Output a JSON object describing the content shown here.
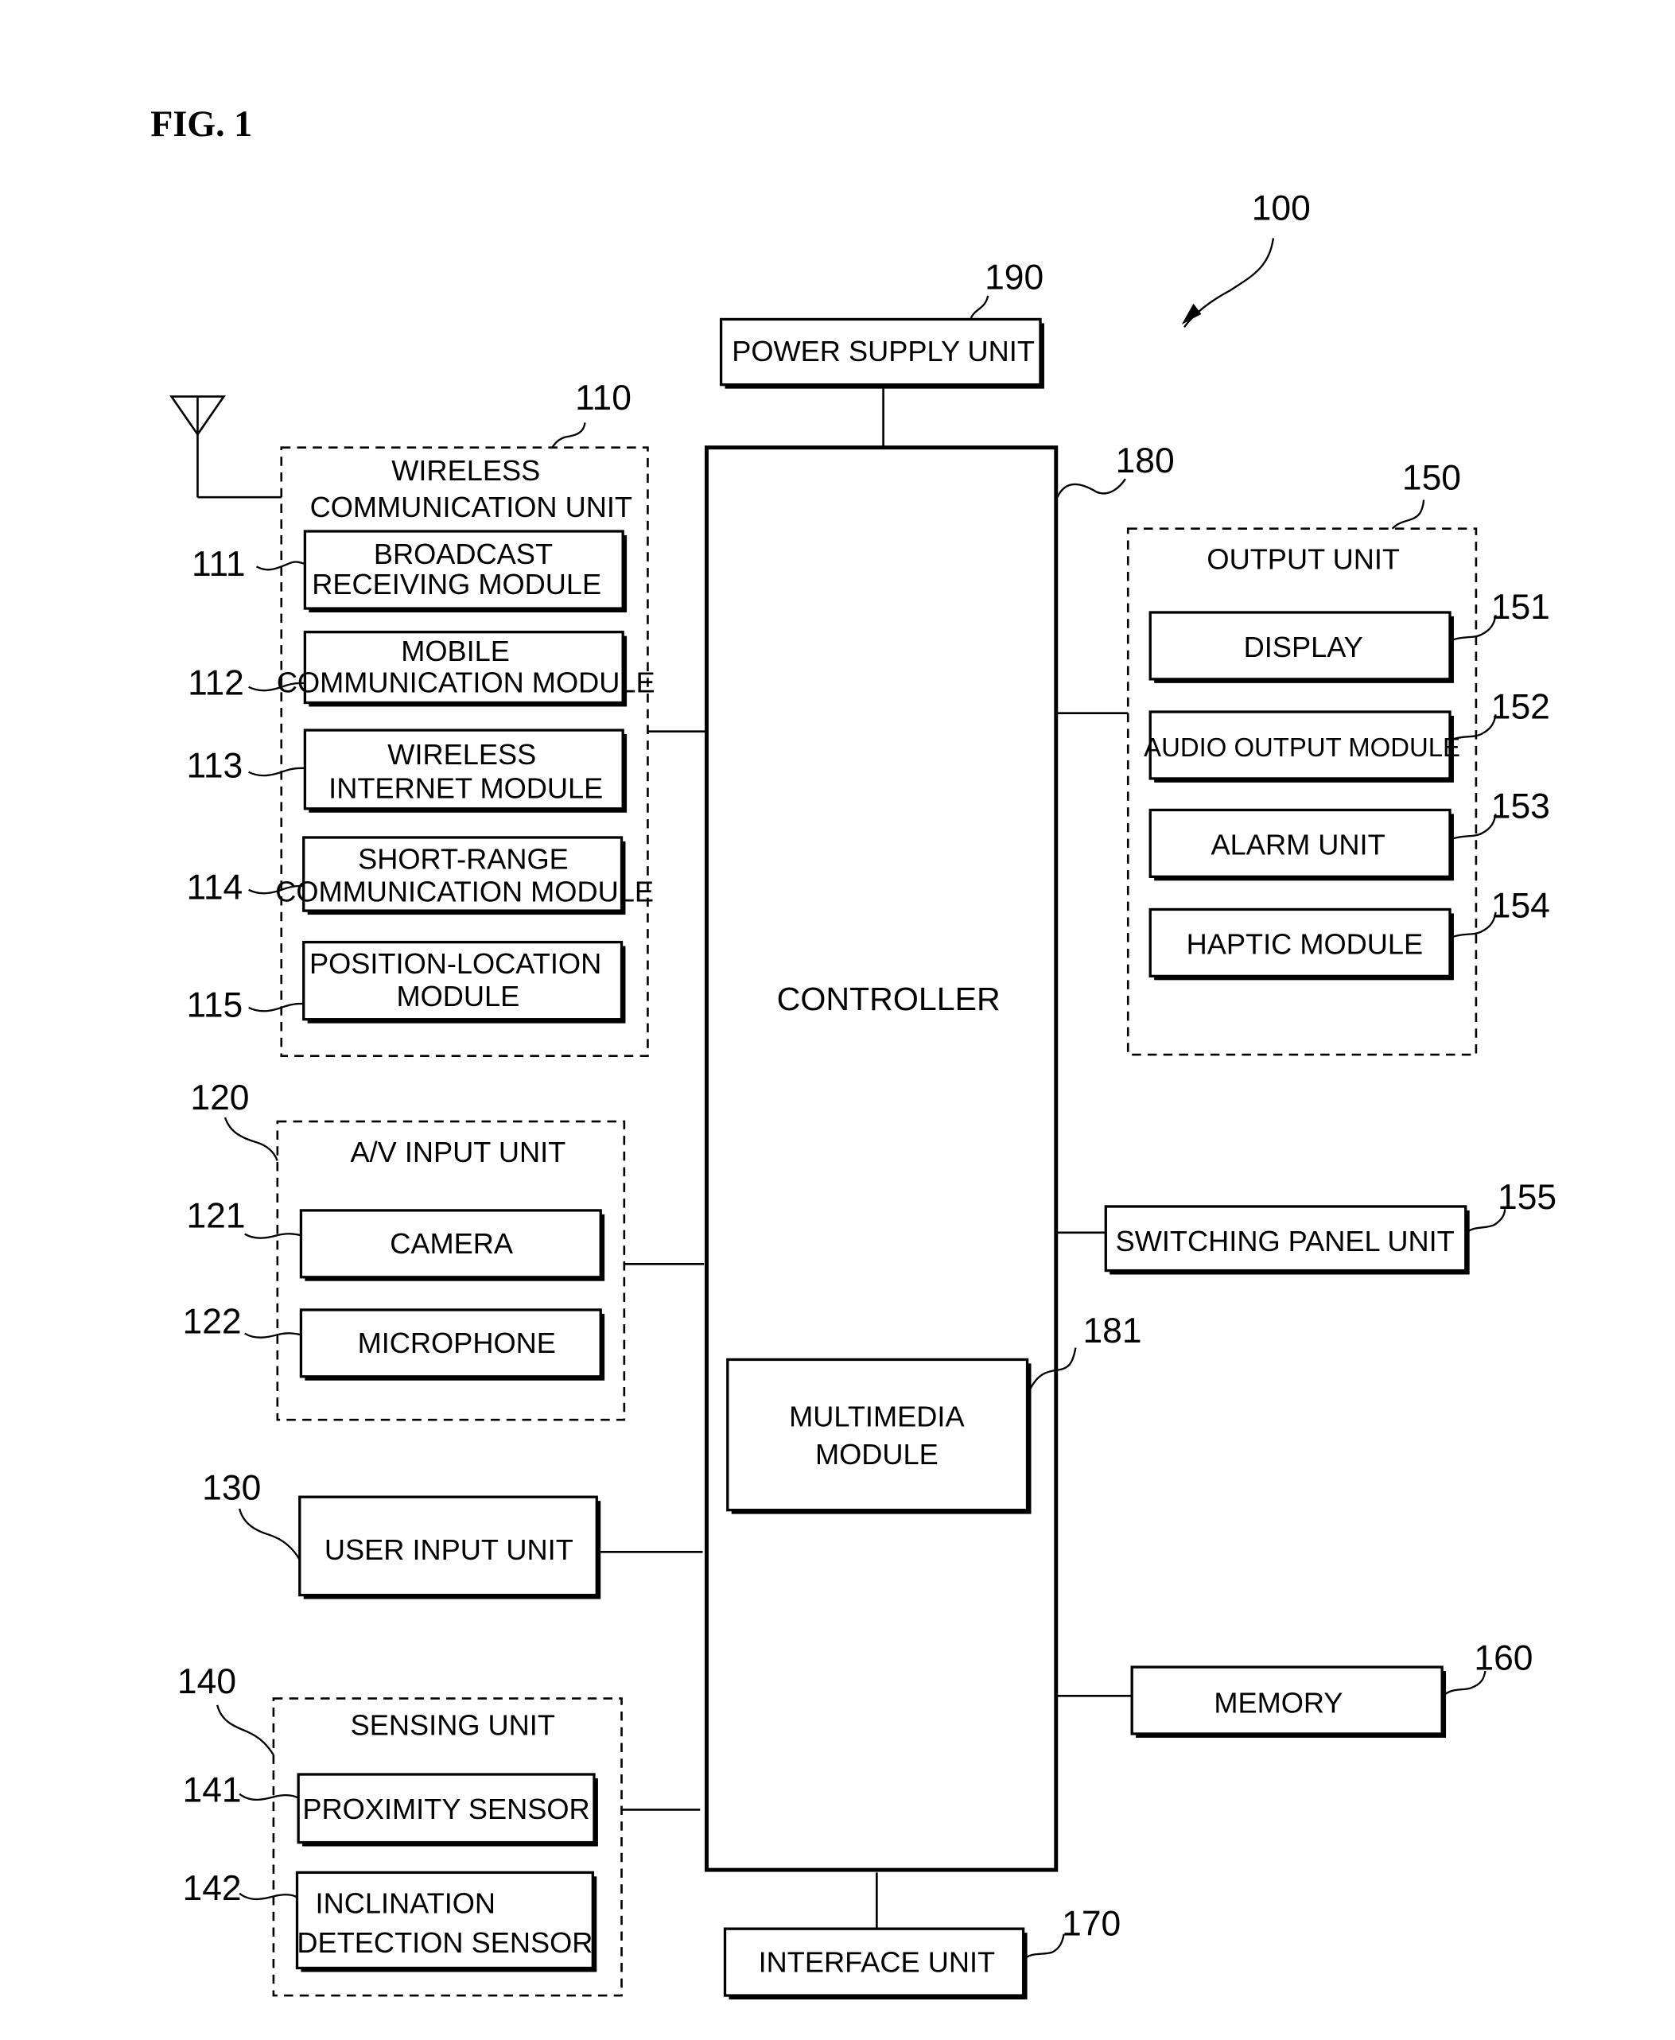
{
  "figure": {
    "title": "FIG. 1",
    "device_ref": "100"
  },
  "power": {
    "label": "POWER SUPPLY UNIT",
    "ref": "190"
  },
  "controller": {
    "label": "CONTROLLER",
    "ref": "180"
  },
  "multimedia": {
    "line1": "MULTIMEDIA",
    "line2": "MODULE",
    "ref": "181"
  },
  "wireless": {
    "title_line1": "WIRELESS",
    "title_line2": "COMMUNICATION UNIT",
    "ref": "110",
    "modules": [
      {
        "line1": "BROADCAST",
        "line2": "RECEIVING MODULE",
        "ref": "111"
      },
      {
        "line1": "MOBILE",
        "line2": "COMMUNICATION MODULE",
        "ref": "112"
      },
      {
        "line1": "WIRELESS",
        "line2": "INTERNET MODULE",
        "ref": "113"
      },
      {
        "line1": "SHORT-RANGE",
        "line2": "COMMUNICATION MODULE",
        "ref": "114"
      },
      {
        "line1": "POSITION-LOCATION",
        "line2": "MODULE",
        "ref": "115"
      }
    ]
  },
  "av_input": {
    "title": "A/V INPUT UNIT",
    "ref": "120",
    "modules": [
      {
        "label": "CAMERA",
        "ref": "121"
      },
      {
        "label": "MICROPHONE",
        "ref": "122"
      }
    ]
  },
  "user_input": {
    "label": "USER INPUT UNIT",
    "ref": "130"
  },
  "sensing": {
    "title": "SENSING UNIT",
    "ref": "140",
    "modules": [
      {
        "line1": "PROXIMITY SENSOR",
        "line2": "",
        "ref": "141"
      },
      {
        "line1": "INCLINATION",
        "line2": "DETECTION SENSOR",
        "ref": "142"
      }
    ]
  },
  "output": {
    "title": "OUTPUT UNIT",
    "ref": "150",
    "modules": [
      {
        "label": "DISPLAY",
        "ref": "151"
      },
      {
        "label": "AUDIO OUTPUT MODULE",
        "ref": "152"
      },
      {
        "label": "ALARM UNIT",
        "ref": "153"
      },
      {
        "label": "HAPTIC MODULE",
        "ref": "154"
      }
    ]
  },
  "switching_panel": {
    "label": "SWITCHING PANEL UNIT",
    "ref": "155"
  },
  "memory": {
    "label": "MEMORY",
    "ref": "160"
  },
  "interface": {
    "label": "INTERFACE UNIT",
    "ref": "170"
  }
}
